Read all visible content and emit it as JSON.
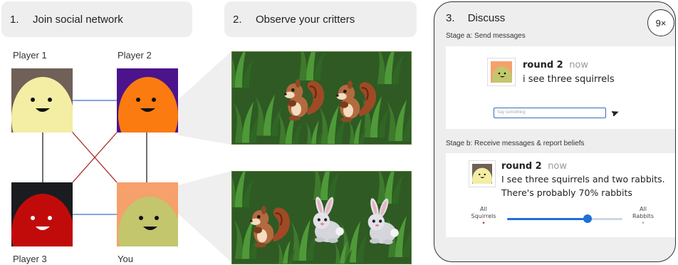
{
  "panel1": {
    "number": "1.",
    "title": "Join social network"
  },
  "panel2": {
    "number": "2.",
    "title": "Observe your critters"
  },
  "panel3": {
    "number": "3.",
    "title": "Discuss",
    "repeat_badge": "9×"
  },
  "players": [
    {
      "label": "Player 1"
    },
    {
      "label": "Player 2"
    },
    {
      "label": "Player 3"
    },
    {
      "label": "You"
    }
  ],
  "stage_a": {
    "label": "Stage a: Send messages",
    "sender": "round 2",
    "time": "now",
    "message": "i see three squirrels",
    "input_placeholder": "Say something"
  },
  "stage_b": {
    "label": "Stage b: Receive messages & report beliefs",
    "sender": "round 2",
    "time": "now",
    "message_line1": "I see three squirrels and two rabbits.",
    "message_line2": "There's probably 70% rabbits",
    "slider_left_line1": "All",
    "slider_left_line2": "Squirrels",
    "slider_right_line1": "All",
    "slider_right_line2": "Rabbits",
    "slider_fraction_rabbits": 0.7
  },
  "colors": {
    "player1_bg": "#6f6058",
    "player1_face": "#f4eda4",
    "player2_bg": "#4b148c",
    "player2_face": "#fb7b10",
    "player3_bg": "#1a1c20",
    "player3_face": "#c10b0b",
    "you_bg": "#f6a06b",
    "you_face": "#c3c66c",
    "edge_blue": "#3a6fce",
    "edge_red": "#a81a1a",
    "edge_black": "#111111",
    "slider_blue": "#1f6fd6"
  },
  "scene1_critters": [
    "squirrel-icon",
    "squirrel-icon"
  ],
  "scene2_critters": [
    "squirrel-icon",
    "rabbit-icon",
    "rabbit-icon"
  ]
}
